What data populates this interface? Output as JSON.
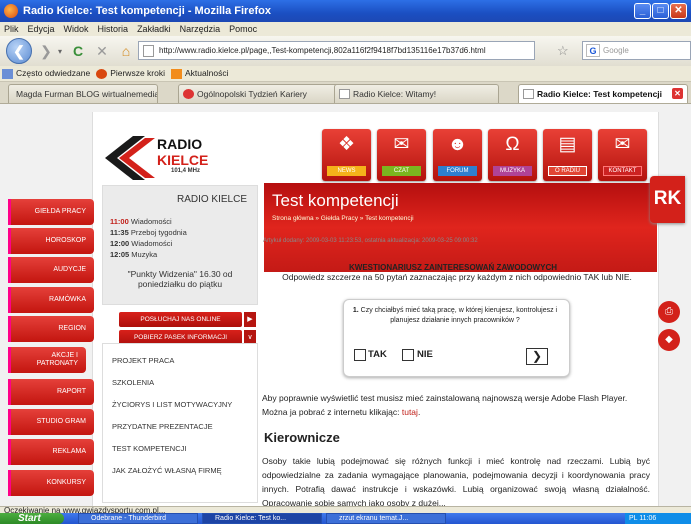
{
  "window": {
    "title": "Radio Kielce: Test kompetencji - Mozilla Firefox",
    "min": "_",
    "max": "□",
    "close": "✕"
  },
  "menu": [
    "Plik",
    "Edycja",
    "Widok",
    "Historia",
    "Zakładki",
    "Narzędzia",
    "Pomoc"
  ],
  "nav": {
    "url": "http://www.radio.kielce.pl/page,,Test-kompetencji,802a116f2f9418f7bd135116e17b37d6.html",
    "search_placeholder": "Google"
  },
  "bookmarks": [
    "Często odwiedzane",
    "Pierwsze kroki",
    "Aktualności"
  ],
  "tabs": [
    "Magda Furman BLOG wirtualnemedia.pl",
    "Ogólnopolski Tydzień Kariery",
    "Radio Kielce: Witamy!",
    "Radio Kielce: Test kompetencji"
  ],
  "site": {
    "logo_top": "RADIO",
    "logo_bottom": "KIELCE",
    "logo_freq": "101,4 MHz",
    "top_nav": [
      "NEWS",
      "CZAT",
      "FORUM",
      "MUZYKA",
      "O RADIU",
      "KONTAKT"
    ],
    "left_nav": [
      "GIEŁDA PRACY",
      "HOROSKOP",
      "AUDYCJE",
      "RAMÓWKA",
      "REGION",
      "AKCJE I PATRONATY",
      "RAPORT",
      "STUDIO GRAM",
      "REKLAMA",
      "KONKURSY"
    ],
    "radio_box": {
      "heading": "RADIO KIELCE",
      "schedule": [
        {
          "time": "11:00",
          "name": "Wiadomości"
        },
        {
          "time": "11:35",
          "name": "Przeboj tygodnia"
        },
        {
          "time": "12:00",
          "name": "Wiadomości"
        },
        {
          "time": "12:05",
          "name": "Muzyka"
        }
      ],
      "promo": "\"Punkty Widzenia\" 16.30 od poniedziałku do piątku",
      "listen_button": "POSŁUCHAJ NAS ONLINE",
      "ticker_button": "POBIERZ PASEK INFORMACJI"
    },
    "side_links": [
      "PROJEKT PRACA",
      "SZKOLENIA",
      "ŻYCIORYS I LIST MOTYWACYJNY",
      "PRZYDATNE PREZENTACJE",
      "TEST KOMPETENCJI",
      "JAK ZAŁOŻYĆ WŁASNĄ FIRMĘ"
    ],
    "page_title": "Test kompetencji",
    "breadcrumb": "Strona główna » Giełda Pracy » Test kompetencji",
    "meta": "Artykuł dodany: 2009-03-03 11:23:53, ostatnia aktualizacja: 2009-03-25 09:00:32",
    "quiz_title": "KWESTIONARIUSZ ZAINTERESOWAŃ ZAWODOWYCH",
    "quiz_subtitle": "Odpowiedz szczerze na 50 pytań zaznaczając przy każdym z nich odpowiednio TAK lub NIE.",
    "question_num": "1.",
    "question": "Czy chciałbyś mieć taką pracę, w której kierujesz, kontrolujesz i planujesz działanie innych pracowników ?",
    "yes": "TAK",
    "no": "NIE",
    "flash_text": "Aby poprawnie wyświetlić test musisz mieć zainstalowaną najnowszą wersje Adobe Flash Player. Można ja pobrać z internetu klikając: ",
    "flash_link": "tutaj",
    "section_heading": "Kierownicze",
    "section_text": "Osoby takie lubią podejmować się różnych funkcji i mieć kontrolę nad rzeczami. Lubią być odpowiedzialne za zadania wymagające planowania, podejmowania decyzji i koordynowania pracy innych. Potrafią dawać instrukcje i wskazówki. Lubią organizować swoją własną działalność. Opracowanie sobie samych jako osoby z dużej..."
  },
  "status": "Oczekiwanie na www.gwiazdysportu.com.pl...",
  "taskbar": {
    "start": "Start",
    "items": [
      "Odebrane - Thunderbird",
      "Radio Kielce: Test ko...",
      "zrzut ekranu temat.J..."
    ],
    "clock": "11:06",
    "lang": "PL"
  }
}
